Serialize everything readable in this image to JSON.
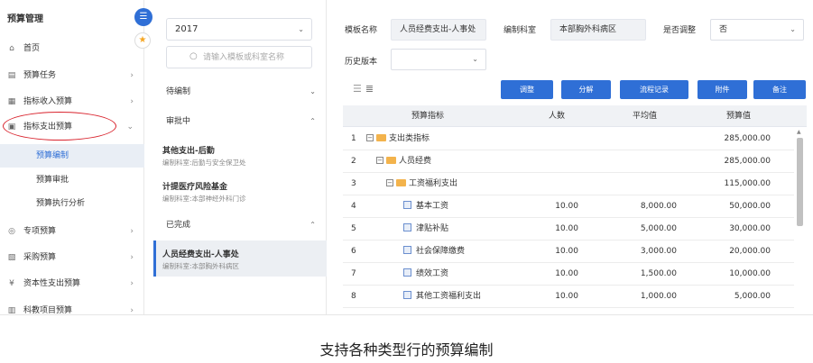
{
  "sidebar": {
    "title": "预算管理",
    "toggle_icon": "list-icon",
    "star_icon": "star-icon",
    "items": [
      {
        "label": "首页",
        "icon": "home-icon",
        "arrow": ""
      },
      {
        "label": "预算任务",
        "icon": "clipboard-icon",
        "arrow": "›"
      },
      {
        "label": "指标收入预算",
        "icon": "chart-icon",
        "arrow": "›"
      },
      {
        "label": "指标支出预算",
        "icon": "document-icon",
        "arrow": "⌄"
      },
      {
        "label": "专项预算",
        "icon": "target-icon",
        "arrow": "›"
      },
      {
        "label": "采购预算",
        "icon": "cart-icon",
        "arrow": "›"
      },
      {
        "label": "资本性支出预算",
        "icon": "money-icon",
        "arrow": "›"
      },
      {
        "label": "科教项目预算",
        "icon": "book-icon",
        "arrow": "›"
      }
    ],
    "subitems": [
      {
        "label": "预算编制",
        "active": true
      },
      {
        "label": "预算审批",
        "active": false
      },
      {
        "label": "预算执行分析",
        "active": false
      }
    ]
  },
  "middle": {
    "year": "2017",
    "search_placeholder": "请输入模板或科室名称",
    "groups": [
      {
        "label": "待编制",
        "chevron": "⌄"
      },
      {
        "label": "审批中",
        "chevron": "⌃"
      },
      {
        "label": "已完成",
        "chevron": "⌃"
      }
    ],
    "tasks": [
      {
        "title": "其他支出-后勤",
        "sub": "编制科室:后勤与安全保卫处"
      },
      {
        "title": "计提医疗风险基金",
        "sub": "编制科室:本部神经外科门诊"
      },
      {
        "title": "人员经费支出-人事处",
        "sub": "编制科室:本部胸外科病区"
      }
    ]
  },
  "main": {
    "template_label": "模板名称",
    "template_value": "人员经费支出-人事处",
    "dept_label": "编制科室",
    "dept_value": "本部胸外科病区",
    "adjust_label": "是否调整",
    "adjust_value": "否",
    "history_label": "历史版本",
    "history_value": "",
    "buttons": [
      "调整",
      "分解",
      "流程记录",
      "附件",
      "备注"
    ],
    "table": {
      "headers": [
        "预算指标",
        "人数",
        "平均值",
        "预算值"
      ],
      "rows": [
        {
          "no": "1",
          "name": "支出类指标",
          "type": "folder",
          "count": "",
          "avg": "",
          "value": "285,000.00"
        },
        {
          "no": "2",
          "name": "人员经费",
          "type": "folder",
          "count": "",
          "avg": "",
          "value": "285,000.00"
        },
        {
          "no": "3",
          "name": "工资福利支出",
          "type": "folder",
          "count": "",
          "avg": "",
          "value": "115,000.00"
        },
        {
          "no": "4",
          "name": "基本工资",
          "type": "leaf",
          "count": "10.00",
          "avg": "8,000.00",
          "value": "50,000.00"
        },
        {
          "no": "5",
          "name": "津贴补贴",
          "type": "leaf",
          "count": "10.00",
          "avg": "5,000.00",
          "value": "30,000.00"
        },
        {
          "no": "6",
          "name": "社会保障缴费",
          "type": "leaf",
          "count": "10.00",
          "avg": "3,000.00",
          "value": "20,000.00"
        },
        {
          "no": "7",
          "name": "绩效工资",
          "type": "leaf",
          "count": "10.00",
          "avg": "1,500.00",
          "value": "10,000.00"
        },
        {
          "no": "8",
          "name": "其他工资福利支出",
          "type": "leaf",
          "count": "10.00",
          "avg": "1,000.00",
          "value": "5,000.00"
        }
      ]
    }
  },
  "caption": "支持各种类型行的预算编制",
  "colors": {
    "accent": "#2f6fd6",
    "highlight_circle": "#d9232d",
    "folder": "#f3b34c"
  }
}
